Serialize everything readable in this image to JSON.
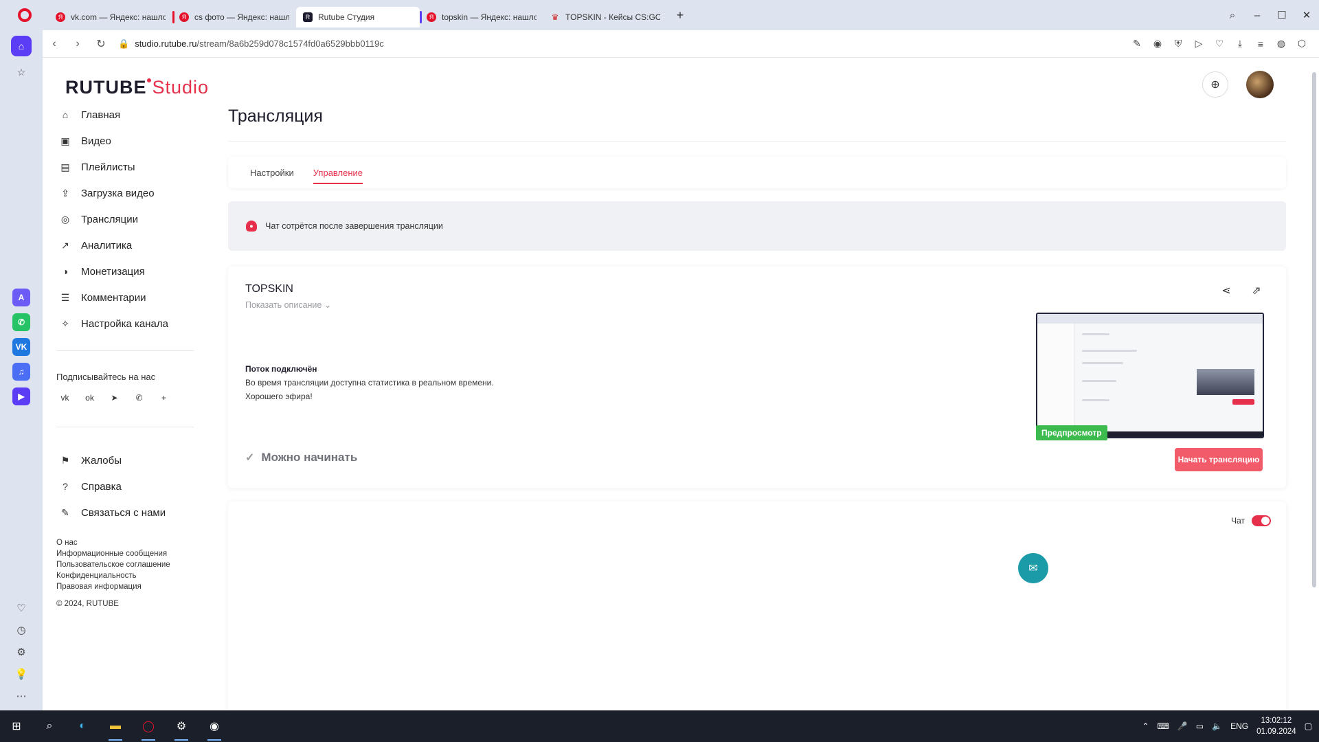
{
  "browser": {
    "tabs": [
      {
        "label": "vk.com — Яндекс: нашло",
        "active": false,
        "mark_color": ""
      },
      {
        "label": "cs фото — Яндекс: нашло",
        "active": false,
        "mark_color": "#e5122c"
      },
      {
        "label": "Rutube Студия",
        "active": true,
        "mark_color": ""
      },
      {
        "label": "topskin — Яндекс: нашло",
        "active": false,
        "mark_color": "#5b3df5"
      },
      {
        "label": "TOPSKIN - Кейсы CS:GO,",
        "active": false,
        "mark_color": ""
      }
    ],
    "url_host": "studio.rutube.ru",
    "url_path": "/stream/8a6b259d078c1574fd0a6529bbb0119c"
  },
  "logo": {
    "main": "RUTUBE",
    "studio": "Studio"
  },
  "sidebar": {
    "items": [
      {
        "label": "Главная",
        "icon": "home-icon"
      },
      {
        "label": "Видео",
        "icon": "video-icon"
      },
      {
        "label": "Плейлисты",
        "icon": "playlist-icon"
      },
      {
        "label": "Загрузка видео",
        "icon": "upload-icon"
      },
      {
        "label": "Трансляции",
        "icon": "broadcast-icon"
      },
      {
        "label": "Аналитика",
        "icon": "analytics-icon"
      },
      {
        "label": "Монетизация",
        "icon": "monetization-icon"
      },
      {
        "label": "Комментарии",
        "icon": "comments-icon"
      },
      {
        "label": "Настройка канала",
        "icon": "wand-icon"
      }
    ],
    "subscribe_label": "Подписывайтесь на нас",
    "socials": [
      "vk-icon",
      "ok-icon",
      "telegram-icon",
      "viber-icon",
      "plus-icon"
    ],
    "secondary": [
      {
        "label": "Жалобы",
        "icon": "flag-icon"
      },
      {
        "label": "Справка",
        "icon": "help-icon"
      },
      {
        "label": "Связаться с нами",
        "icon": "pen-icon"
      }
    ],
    "footer_links": [
      "О нас",
      "Информационные сообщения",
      "Пользовательское соглашение",
      "Конфиденциальность",
      "Правовая информация"
    ],
    "copyright": "© 2024, RUTUBE"
  },
  "main": {
    "title": "Трансляция",
    "tabs": [
      {
        "label": "Настройки",
        "active": false
      },
      {
        "label": "Управление",
        "active": true
      }
    ],
    "notice": "Чат сотрётся после завершения трансляции",
    "stream": {
      "name": "TOPSKIN",
      "show_description": "Показать описание",
      "status_title": "Поток подключён",
      "status_line1": "Во время трансляции доступна статистика в реальном времени.",
      "status_line2": "Хорошего эфира!",
      "preview_badge": "Предпросмотр",
      "ready_label": "Можно начинать",
      "start_button": "Начать трансляцию"
    },
    "chat_label": "Чат",
    "chat_enabled": true
  },
  "taskbar": {
    "lang": "ENG",
    "time": "13:02:12",
    "date": "01.09.2024"
  },
  "colors": {
    "accent": "#e6304b",
    "preview_badge": "#3dba4e",
    "start_button": "#f25b6a"
  }
}
